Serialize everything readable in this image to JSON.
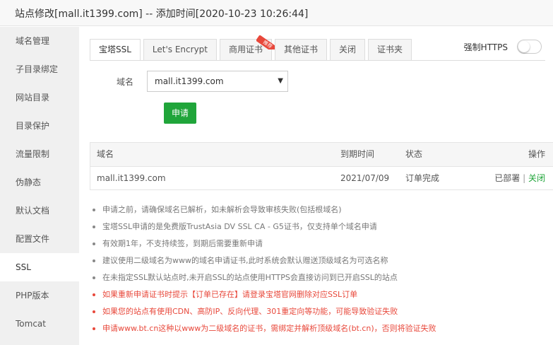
{
  "window": {
    "title": "站点修改[mall.it1399.com] -- 添加时间[2020-10-23 10:26:44]"
  },
  "sidebar": {
    "items": [
      {
        "label": "域名管理"
      },
      {
        "label": "子目录绑定"
      },
      {
        "label": "网站目录"
      },
      {
        "label": "目录保护"
      },
      {
        "label": "流量限制"
      },
      {
        "label": "伪静态"
      },
      {
        "label": "默认文档"
      },
      {
        "label": "配置文件"
      },
      {
        "label": "SSL",
        "active": true
      },
      {
        "label": "PHP版本"
      },
      {
        "label": "Tomcat"
      }
    ]
  },
  "tabs": [
    {
      "label": "宝塔SSL",
      "active": true
    },
    {
      "label": "Let's Encrypt"
    },
    {
      "label": "商用证书",
      "badge": "推荐"
    },
    {
      "label": "其他证书"
    },
    {
      "label": "关闭"
    },
    {
      "label": "证书夹"
    }
  ],
  "force_https": {
    "label": "强制HTTPS",
    "enabled": false
  },
  "form": {
    "domain_label": "域名",
    "domain_value": "mall.it1399.com",
    "apply_label": "申请"
  },
  "table": {
    "headers": {
      "domain": "域名",
      "expire": "到期时间",
      "status": "状态",
      "action": "操作"
    },
    "rows": [
      {
        "domain": "mall.it1399.com",
        "expire": "2021/07/09",
        "status": "订单完成",
        "deployed": "已部署",
        "separator": "|",
        "close": "关闭"
      }
    ]
  },
  "tips": [
    {
      "text": "申请之前，请确保域名已解析，如未解析会导致审核失败(包括根域名)"
    },
    {
      "text": "宝塔SSL申请的是免费版TrustAsia DV SSL CA - G5证书，仅支持单个域名申请"
    },
    {
      "text": "有效期1年，不支持续签，到期后需要重新申请"
    },
    {
      "text": "建议使用二级域名为www的域名申请证书,此时系统会默认赠送顶级域名为可选名称"
    },
    {
      "text": "在未指定SSL默认站点时,未开启SSL的站点使用HTTPS会直接访问到已开启SSL的站点"
    },
    {
      "text": "如果重新申请证书时提示【订单已存在】请登录宝塔官网删除对应SSL订单",
      "warning": true
    },
    {
      "text": "如果您的站点有使用CDN、高防IP、反向代理、301重定向等功能，可能导致验证失败",
      "warning": true
    },
    {
      "text": "申请www.bt.cn这种以www为二级域名的证书，需绑定并解析顶级域名(bt.cn)，否则将验证失败",
      "warning": true
    }
  ],
  "colors": {
    "accent": "#20a53a",
    "warning": "#e8483b",
    "sidebar_bg": "#f0f0f0"
  }
}
